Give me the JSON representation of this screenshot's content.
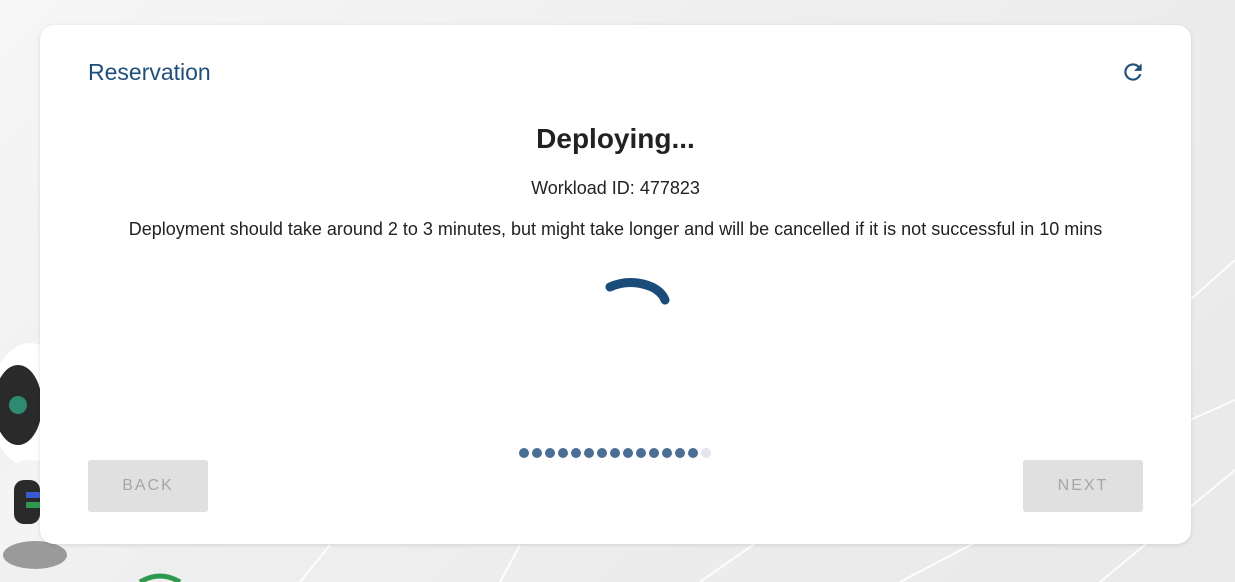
{
  "card": {
    "title": "Reservation",
    "refresh_icon": "refresh-icon"
  },
  "status": {
    "title": "Deploying...",
    "workload_label": "Workload ID:",
    "workload_id": "477823",
    "info": "Deployment should take around 2 to 3 minutes, but might take longer and will be cancelled if it is not successful in 10 mins"
  },
  "stepper": {
    "total_steps": 15,
    "completed_steps": 14
  },
  "buttons": {
    "back_label": "BACK",
    "next_label": "NEXT"
  },
  "colors": {
    "accent": "#1f4f7a",
    "spinner": "#1b4b78",
    "step_active": "#4a6e94",
    "step_inactive": "#e3e6ea",
    "disabled_button_bg": "#e0e0e0",
    "disabled_button_text": "#a6a6a6"
  }
}
